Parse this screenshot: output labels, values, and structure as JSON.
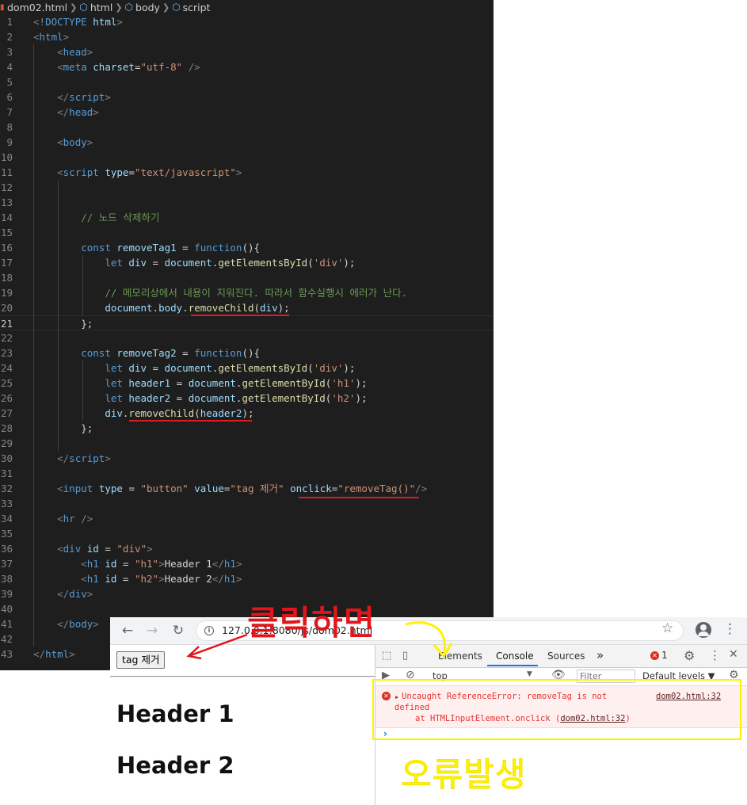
{
  "editor": {
    "breadcrumb": [
      "dom02.html",
      "html",
      "body",
      "script"
    ],
    "lines": [
      {
        "n": "1",
        "tokens": [
          [
            "t-br",
            "<!"
          ],
          [
            "t-doc",
            "DOCTYPE"
          ],
          [
            "t-pl",
            " "
          ],
          [
            "t-attr",
            "html"
          ],
          [
            "t-br",
            ">"
          ]
        ]
      },
      {
        "n": "2",
        "tokens": [
          [
            "t-br",
            "<"
          ],
          [
            "t-tag",
            "html"
          ],
          [
            "t-br",
            ">"
          ]
        ]
      },
      {
        "n": "3",
        "tokens": [
          [
            "t-pl",
            "    "
          ],
          [
            "t-br",
            "<"
          ],
          [
            "t-tag",
            "head"
          ],
          [
            "t-br",
            ">"
          ]
        ]
      },
      {
        "n": "4",
        "tokens": [
          [
            "t-pl",
            "    "
          ],
          [
            "t-br",
            "<"
          ],
          [
            "t-tag",
            "meta"
          ],
          [
            "t-pl",
            " "
          ],
          [
            "t-attr",
            "charset"
          ],
          [
            "t-pl",
            "="
          ],
          [
            "t-str",
            "\"utf-8\""
          ],
          [
            "t-pl",
            " "
          ],
          [
            "t-br",
            "/>"
          ]
        ]
      },
      {
        "n": "5",
        "tokens": []
      },
      {
        "n": "6",
        "tokens": [
          [
            "t-pl",
            "    "
          ],
          [
            "t-br",
            "</"
          ],
          [
            "t-tag",
            "script"
          ],
          [
            "t-br",
            ">"
          ]
        ]
      },
      {
        "n": "7",
        "tokens": [
          [
            "t-pl",
            "    "
          ],
          [
            "t-br",
            "</"
          ],
          [
            "t-tag",
            "head"
          ],
          [
            "t-br",
            ">"
          ]
        ]
      },
      {
        "n": "8",
        "tokens": []
      },
      {
        "n": "9",
        "tokens": [
          [
            "t-pl",
            "    "
          ],
          [
            "t-br",
            "<"
          ],
          [
            "t-tag",
            "body"
          ],
          [
            "t-br",
            ">"
          ]
        ]
      },
      {
        "n": "10",
        "tokens": []
      },
      {
        "n": "11",
        "tokens": [
          [
            "t-pl",
            "    "
          ],
          [
            "t-br",
            "<"
          ],
          [
            "t-tag",
            "script"
          ],
          [
            "t-pl",
            " "
          ],
          [
            "t-attr",
            "type"
          ],
          [
            "t-pl",
            "="
          ],
          [
            "t-str",
            "\"text/javascript\""
          ],
          [
            "t-br",
            ">"
          ]
        ]
      },
      {
        "n": "12",
        "tokens": []
      },
      {
        "n": "13",
        "tokens": []
      },
      {
        "n": "14",
        "tokens": [
          [
            "t-pl",
            "        "
          ],
          [
            "t-com",
            "// 노드 삭제하기"
          ]
        ]
      },
      {
        "n": "15",
        "tokens": []
      },
      {
        "n": "16",
        "tokens": [
          [
            "t-pl",
            "        "
          ],
          [
            "t-kw",
            "const"
          ],
          [
            "t-pl",
            " "
          ],
          [
            "t-var",
            "removeTag1"
          ],
          [
            "t-pl",
            " = "
          ],
          [
            "t-kw",
            "function"
          ],
          [
            "t-pl",
            "(){"
          ]
        ]
      },
      {
        "n": "17",
        "tokens": [
          [
            "t-pl",
            "            "
          ],
          [
            "t-kw",
            "let"
          ],
          [
            "t-pl",
            " "
          ],
          [
            "t-var",
            "div"
          ],
          [
            "t-pl",
            " = "
          ],
          [
            "t-var",
            "document"
          ],
          [
            "t-pl",
            "."
          ],
          [
            "t-fn",
            "getElementsById"
          ],
          [
            "t-pl",
            "("
          ],
          [
            "t-str",
            "'div'"
          ],
          [
            "t-pl",
            ");"
          ]
        ]
      },
      {
        "n": "18",
        "tokens": []
      },
      {
        "n": "19",
        "tokens": [
          [
            "t-pl",
            "            "
          ],
          [
            "t-com",
            "// 메모리상에서 내용이 지워진다. 따라서 함수실행시 에러가 난다."
          ]
        ]
      },
      {
        "n": "20",
        "tokens": [
          [
            "t-pl",
            "            "
          ],
          [
            "t-var",
            "document"
          ],
          [
            "t-pl",
            "."
          ],
          [
            "t-var",
            "body"
          ],
          [
            "t-pl",
            "."
          ],
          [
            "t-fn",
            "removeChild"
          ],
          [
            "t-pl",
            "("
          ],
          [
            "t-var",
            "div"
          ],
          [
            "t-pl",
            ");"
          ]
        ]
      },
      {
        "n": "21",
        "tokens": [
          [
            "t-pl",
            "        };"
          ]
        ]
      },
      {
        "n": "22",
        "tokens": []
      },
      {
        "n": "23",
        "tokens": [
          [
            "t-pl",
            "        "
          ],
          [
            "t-kw",
            "const"
          ],
          [
            "t-pl",
            " "
          ],
          [
            "t-var",
            "removeTag2"
          ],
          [
            "t-pl",
            " = "
          ],
          [
            "t-kw",
            "function"
          ],
          [
            "t-pl",
            "(){"
          ]
        ]
      },
      {
        "n": "24",
        "tokens": [
          [
            "t-pl",
            "            "
          ],
          [
            "t-kw",
            "let"
          ],
          [
            "t-pl",
            " "
          ],
          [
            "t-var",
            "div"
          ],
          [
            "t-pl",
            " = "
          ],
          [
            "t-var",
            "document"
          ],
          [
            "t-pl",
            "."
          ],
          [
            "t-fn",
            "getElementsById"
          ],
          [
            "t-pl",
            "("
          ],
          [
            "t-str",
            "'div'"
          ],
          [
            "t-pl",
            ");"
          ]
        ]
      },
      {
        "n": "25",
        "tokens": [
          [
            "t-pl",
            "            "
          ],
          [
            "t-kw",
            "let"
          ],
          [
            "t-pl",
            " "
          ],
          [
            "t-var",
            "header1"
          ],
          [
            "t-pl",
            " = "
          ],
          [
            "t-var",
            "document"
          ],
          [
            "t-pl",
            "."
          ],
          [
            "t-fn",
            "getElementById"
          ],
          [
            "t-pl",
            "("
          ],
          [
            "t-str",
            "'h1'"
          ],
          [
            "t-pl",
            ");"
          ]
        ]
      },
      {
        "n": "26",
        "tokens": [
          [
            "t-pl",
            "            "
          ],
          [
            "t-kw",
            "let"
          ],
          [
            "t-pl",
            " "
          ],
          [
            "t-var",
            "header2"
          ],
          [
            "t-pl",
            " = "
          ],
          [
            "t-var",
            "document"
          ],
          [
            "t-pl",
            "."
          ],
          [
            "t-fn",
            "getElementById"
          ],
          [
            "t-pl",
            "("
          ],
          [
            "t-str",
            "'h2'"
          ],
          [
            "t-pl",
            ");"
          ]
        ]
      },
      {
        "n": "27",
        "tokens": [
          [
            "t-pl",
            "            "
          ],
          [
            "t-var",
            "div"
          ],
          [
            "t-pl",
            "."
          ],
          [
            "t-fn",
            "removeChild"
          ],
          [
            "t-pl",
            "("
          ],
          [
            "t-var",
            "header2"
          ],
          [
            "t-pl",
            ");"
          ]
        ]
      },
      {
        "n": "28",
        "tokens": [
          [
            "t-pl",
            "        };"
          ]
        ]
      },
      {
        "n": "29",
        "tokens": []
      },
      {
        "n": "30",
        "tokens": [
          [
            "t-pl",
            "    "
          ],
          [
            "t-br",
            "</"
          ],
          [
            "t-tag",
            "script"
          ],
          [
            "t-br",
            ">"
          ]
        ]
      },
      {
        "n": "31",
        "tokens": []
      },
      {
        "n": "32",
        "tokens": [
          [
            "t-pl",
            "    "
          ],
          [
            "t-br",
            "<"
          ],
          [
            "t-tag",
            "input"
          ],
          [
            "t-pl",
            " "
          ],
          [
            "t-attr",
            "type"
          ],
          [
            "t-pl",
            " = "
          ],
          [
            "t-str",
            "\"button\""
          ],
          [
            "t-pl",
            " "
          ],
          [
            "t-attr",
            "value"
          ],
          [
            "t-pl",
            "="
          ],
          [
            "t-str",
            "\"tag 제거\""
          ],
          [
            "t-pl",
            " "
          ],
          [
            "t-attr",
            "onclick"
          ],
          [
            "t-pl",
            "="
          ],
          [
            "t-str",
            "\"removeTag()\""
          ],
          [
            "t-br",
            "/>"
          ]
        ]
      },
      {
        "n": "33",
        "tokens": []
      },
      {
        "n": "34",
        "tokens": [
          [
            "t-pl",
            "    "
          ],
          [
            "t-br",
            "<"
          ],
          [
            "t-tag",
            "hr"
          ],
          [
            "t-pl",
            " "
          ],
          [
            "t-br",
            "/>"
          ]
        ]
      },
      {
        "n": "35",
        "tokens": []
      },
      {
        "n": "36",
        "tokens": [
          [
            "t-pl",
            "    "
          ],
          [
            "t-br",
            "<"
          ],
          [
            "t-tag",
            "div"
          ],
          [
            "t-pl",
            " "
          ],
          [
            "t-attr",
            "id"
          ],
          [
            "t-pl",
            " = "
          ],
          [
            "t-str",
            "\"div\""
          ],
          [
            "t-br",
            ">"
          ]
        ]
      },
      {
        "n": "37",
        "tokens": [
          [
            "t-pl",
            "        "
          ],
          [
            "t-br",
            "<"
          ],
          [
            "t-tag",
            "h1"
          ],
          [
            "t-pl",
            " "
          ],
          [
            "t-attr",
            "id"
          ],
          [
            "t-pl",
            " = "
          ],
          [
            "t-str",
            "\"h1\""
          ],
          [
            "t-br",
            ">"
          ],
          [
            "t-pl",
            "Header 1"
          ],
          [
            "t-br",
            "</"
          ],
          [
            "t-tag",
            "h1"
          ],
          [
            "t-br",
            ">"
          ]
        ]
      },
      {
        "n": "38",
        "tokens": [
          [
            "t-pl",
            "        "
          ],
          [
            "t-br",
            "<"
          ],
          [
            "t-tag",
            "h1"
          ],
          [
            "t-pl",
            " "
          ],
          [
            "t-attr",
            "id"
          ],
          [
            "t-pl",
            " = "
          ],
          [
            "t-str",
            "\"h2\""
          ],
          [
            "t-br",
            ">"
          ],
          [
            "t-pl",
            "Header 2"
          ],
          [
            "t-br",
            "</"
          ],
          [
            "t-tag",
            "h1"
          ],
          [
            "t-br",
            ">"
          ]
        ]
      },
      {
        "n": "39",
        "tokens": [
          [
            "t-pl",
            "    "
          ],
          [
            "t-br",
            "</"
          ],
          [
            "t-tag",
            "div"
          ],
          [
            "t-br",
            ">"
          ]
        ]
      },
      {
        "n": "40",
        "tokens": []
      },
      {
        "n": "41",
        "tokens": [
          [
            "t-pl",
            "    "
          ],
          [
            "t-br",
            "</"
          ],
          [
            "t-tag",
            "body"
          ],
          [
            "t-br",
            ">"
          ]
        ]
      },
      {
        "n": "42",
        "tokens": []
      },
      {
        "n": "43",
        "tokens": [
          [
            "t-br",
            "</"
          ],
          [
            "t-tag",
            "html"
          ],
          [
            "t-br",
            ">"
          ]
        ]
      }
    ]
  },
  "browser": {
    "url": "127.0.0.1:8080/js/dom02.html",
    "page": {
      "button_label": "tag 제거",
      "header1": "Header 1",
      "header2": "Header 2"
    },
    "devtools": {
      "tabs": [
        "Elements",
        "Console",
        "Sources"
      ],
      "active_tab": "Console",
      "more_tabs": "»",
      "error_count": "1",
      "context": "top",
      "filter_placeholder": "Filter",
      "levels": "Default levels ▼",
      "error": {
        "message_line1": "Uncaught ReferenceError: removeTag is not",
        "message_line2": "defined",
        "stack_prefix": "at HTMLInputElement.onclick (",
        "stack_link": "dom02.html:32",
        "stack_suffix": ")",
        "source": "dom02.html:32"
      },
      "prompt": "›"
    }
  },
  "annotations": {
    "click_text": "클릭하면",
    "error_text": "오류발생",
    "colors": {
      "red": "#e0161b",
      "yellow": "#fff200"
    }
  }
}
